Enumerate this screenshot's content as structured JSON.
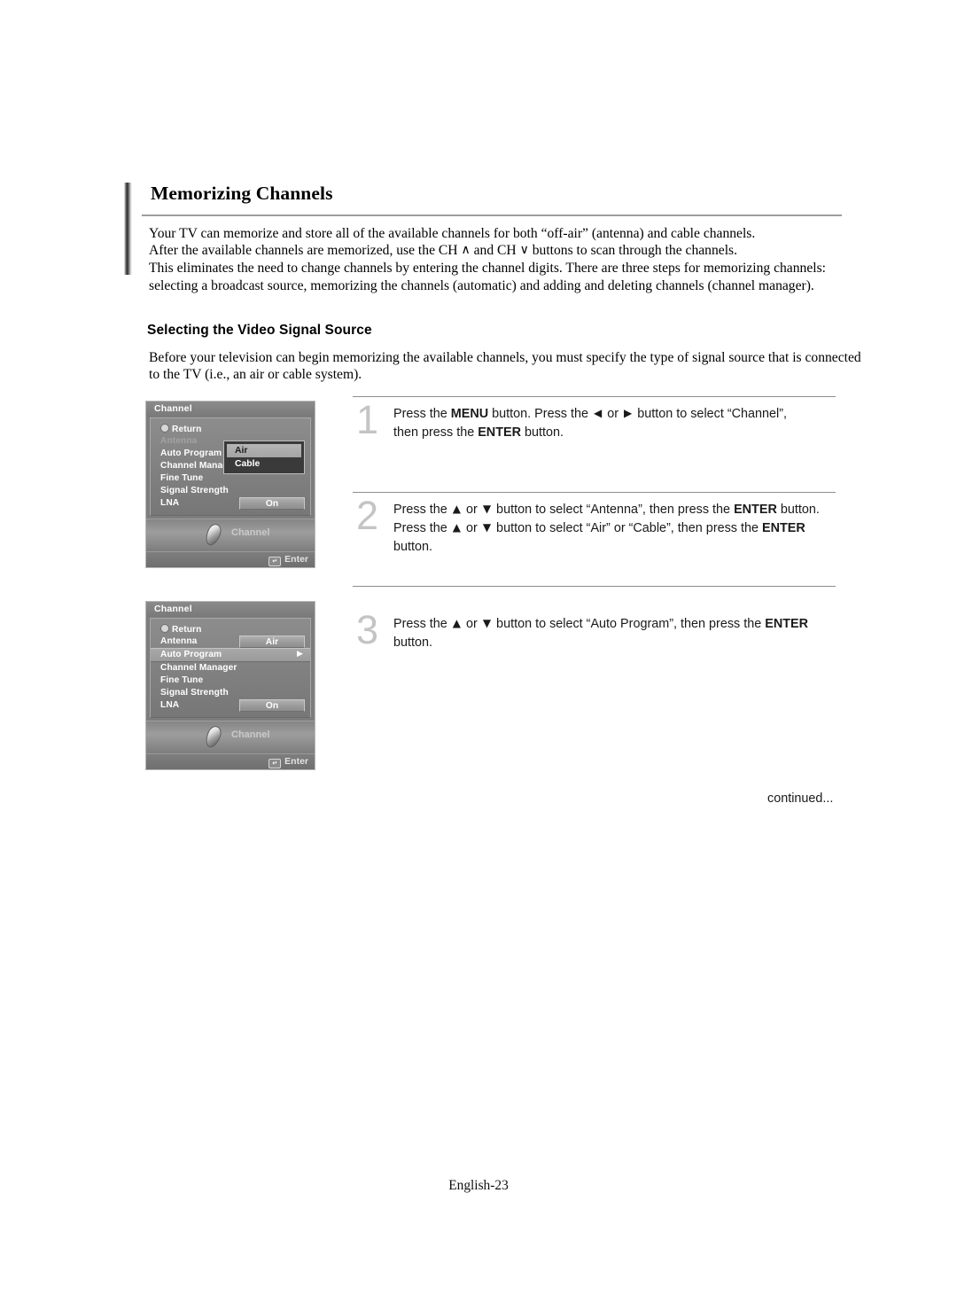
{
  "document": {
    "title": "Memorizing Channels",
    "intro_lines": [
      "Your TV can memorize and store all of the available channels for both “off-air” (antenna) and cable channels.",
      "After the available channels are memorized, use the CH ∧ and CH ∨ buttons to scan through the channels.",
      "This eliminates the need to change channels by entering the channel digits. There are three steps for memorizing channels:",
      "selecting a broadcast source, memorizing the channels (automatic) and adding and deleting channels (channel manager)."
    ],
    "section_heading": "Selecting the Video Signal Source",
    "section_lines": [
      "Before your television can begin memorizing the available channels, you must specify the type of signal source that is connected",
      "to the TV (i.e., an air or cable system)."
    ],
    "continued_label": "continued...",
    "page_footer": "English-23"
  },
  "steps": [
    {
      "number": "1",
      "lines": [
        [
          {
            "t": "Press the ",
            "b": false
          },
          {
            "t": "MENU",
            "b": true
          },
          {
            "t": " button. Press the ",
            "b": false
          },
          {
            "t": "◀",
            "b": false,
            "arrow": true
          },
          {
            "t": " or ",
            "b": false
          },
          {
            "t": "▶",
            "b": false,
            "arrow": true
          },
          {
            "t": " button to select “Channel”,",
            "b": false
          }
        ],
        [
          {
            "t": "then press the ",
            "b": false
          },
          {
            "t": "ENTER",
            "b": true
          },
          {
            "t": " button.",
            "b": false
          }
        ]
      ]
    },
    {
      "number": "2",
      "lines": [
        [
          {
            "t": "Press the ",
            "b": false
          },
          {
            "t": "▲",
            "b": false,
            "arrow": true
          },
          {
            "t": " or ",
            "b": false
          },
          {
            "t": "▼",
            "b": false,
            "arrow": true
          },
          {
            "t": " button to select “Antenna”, then press the ",
            "b": false
          },
          {
            "t": "ENTER",
            "b": true
          },
          {
            "t": " button.",
            "b": false
          }
        ],
        [
          {
            "t": "Press the ",
            "b": false
          },
          {
            "t": "▲",
            "b": false,
            "arrow": true
          },
          {
            "t": " or ",
            "b": false
          },
          {
            "t": "▼",
            "b": false,
            "arrow": true
          },
          {
            "t": " button to select “Air” or “Cable”, then press the ",
            "b": false
          },
          {
            "t": "ENTER",
            "b": true
          }
        ],
        [
          {
            "t": "button.",
            "b": false
          }
        ]
      ]
    },
    {
      "number": "3",
      "lines": [
        [
          {
            "t": "Press the ",
            "b": false
          },
          {
            "t": "▲",
            "b": false,
            "arrow": true
          },
          {
            "t": " or ",
            "b": false
          },
          {
            "t": "▼",
            "b": false,
            "arrow": true
          },
          {
            "t": " button to select “Auto Program”, then press the ",
            "b": false
          },
          {
            "t": "ENTER",
            "b": true
          }
        ],
        [
          {
            "t": "button.",
            "b": false
          }
        ]
      ]
    }
  ],
  "osd_menus": [
    {
      "title": "Channel",
      "rows": [
        {
          "label": "Return",
          "style": "return"
        },
        {
          "label": "Antenna",
          "style": "dim"
        },
        {
          "label": "Auto Program",
          "style": "normal"
        },
        {
          "label": "Channel Manager",
          "style": "normal"
        },
        {
          "label": "Fine Tune",
          "style": "normal"
        },
        {
          "label": "Signal Strength",
          "style": "normal"
        },
        {
          "label": "LNA",
          "style": "normal",
          "value": "On"
        }
      ],
      "popup": {
        "items": [
          {
            "label": "Air",
            "highlighted": true
          },
          {
            "label": "Cable",
            "highlighted": false
          }
        ]
      },
      "footer_label": "Channel",
      "enter_label": "Enter"
    },
    {
      "title": "Channel",
      "rows": [
        {
          "label": "Return",
          "style": "return"
        },
        {
          "label": "Antenna",
          "style": "normal",
          "value": "Air"
        },
        {
          "label": "Auto Program",
          "style": "selected",
          "arrow": "▶"
        },
        {
          "label": "Channel Manager",
          "style": "normal"
        },
        {
          "label": "Fine Tune",
          "style": "normal"
        },
        {
          "label": "Signal Strength",
          "style": "normal"
        },
        {
          "label": "LNA",
          "style": "normal",
          "value": "On"
        }
      ],
      "popup": null,
      "footer_label": "Channel",
      "enter_label": "Enter"
    }
  ],
  "colors": {
    "page_background": "#ffffff",
    "text": "#000000",
    "rule": "#9d9d9d",
    "step_number": "#c4c4c4",
    "osd_panel": "#7d7d7d",
    "osd_popup": "#3a3a3a",
    "osd_highlight": "#aaaaaa"
  }
}
